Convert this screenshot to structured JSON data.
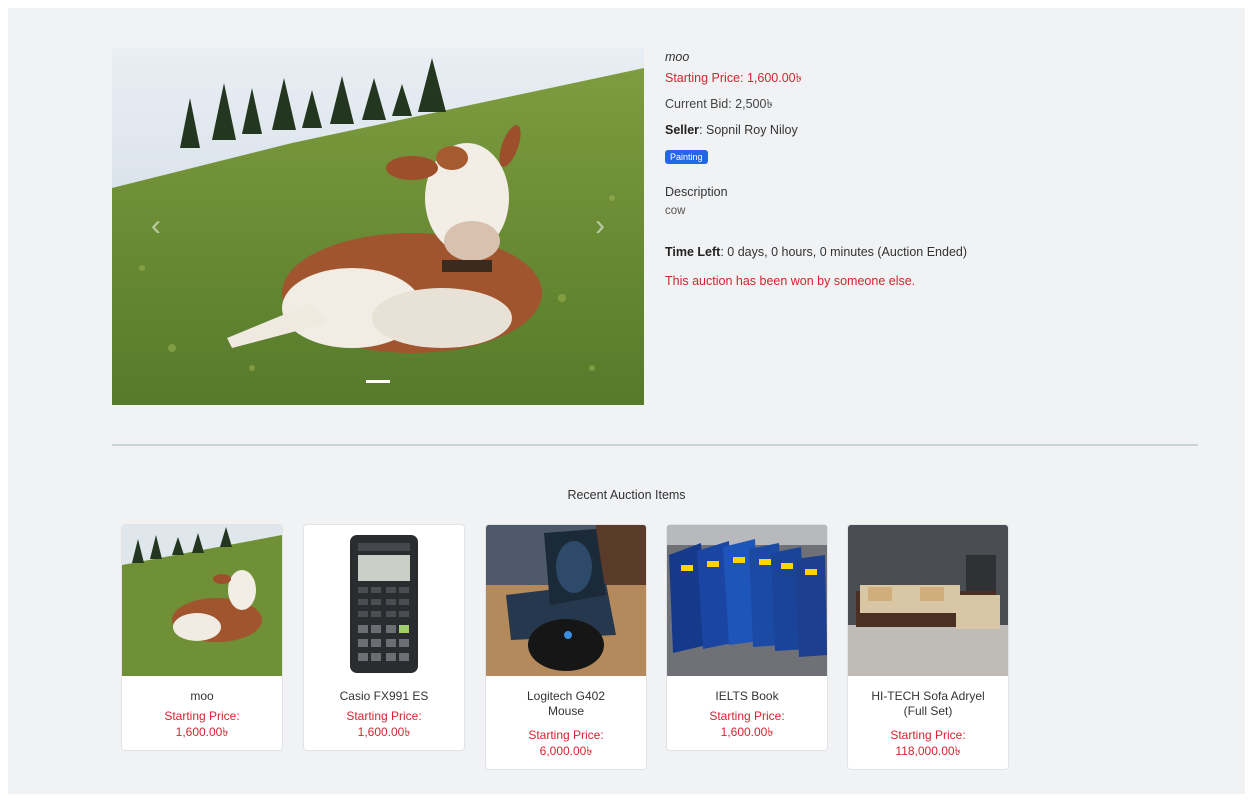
{
  "item": {
    "title": "moo",
    "starting_price": "Starting Price: 1,600.00৳",
    "current_bid": "Current Bid: 2,500৳",
    "seller_label": "Seller",
    "seller_name": ": Sopnil Roy Niloy",
    "category_badge": "Painting",
    "description_label": "Description",
    "description": "cow",
    "time_left_label": "Time Left",
    "time_left": ": 0 days, 0 hours, 0 minutes (Auction Ended)",
    "status_message": "This auction has been won by someone else."
  },
  "carousel": {
    "prev_icon": "chevron-left-icon",
    "next_icon": "chevron-right-icon",
    "prev_glyph": "‹",
    "next_glyph": "›"
  },
  "recent": {
    "title": "Recent Auction Items",
    "items": [
      {
        "name": "moo",
        "price_label": "Starting Price:",
        "price": "1,600.00৳"
      },
      {
        "name": "Casio FX991 ES",
        "price_label": "Starting Price:",
        "price": "1,600.00৳"
      },
      {
        "name": "Logitech G402 Mouse",
        "price_label": "Starting Price:",
        "price": "6,000.00৳"
      },
      {
        "name": "IELTS Book",
        "price_label": "Starting Price:",
        "price": "1,600.00৳"
      },
      {
        "name": "HI-TECH Sofa Adryel (Full Set)",
        "price_label": "Starting Price:",
        "price": "118,000.00৳"
      }
    ]
  },
  "colors": {
    "accent_red": "#d4242f",
    "badge_blue": "#2467e6"
  }
}
